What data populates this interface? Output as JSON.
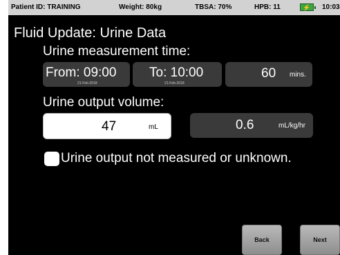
{
  "status_bar": {
    "patient": "Patient ID: TRAINING",
    "weight": "Weight: 80kg",
    "tbsa": "TBSA: 70%",
    "hpb": "HPB: 11",
    "time": "10:03"
  },
  "title": "Fluid Update: Urine Data",
  "measurement_time": {
    "label": "Urine measurement time:",
    "from_label": "From: 09:00",
    "from_date": "21-Feb-2018",
    "to_label": "To: 10:00",
    "to_date": "21-Feb-2018",
    "duration_value": "60",
    "duration_unit": "mins."
  },
  "output_volume": {
    "label": "Urine output volume:",
    "value": "47",
    "unit": "mL",
    "rate_value": "0.6",
    "rate_unit": "mL/kg/hr"
  },
  "not_measured_label": "Urine output not measured or unknown.",
  "buttons": {
    "back": "Back",
    "next": "Next"
  }
}
